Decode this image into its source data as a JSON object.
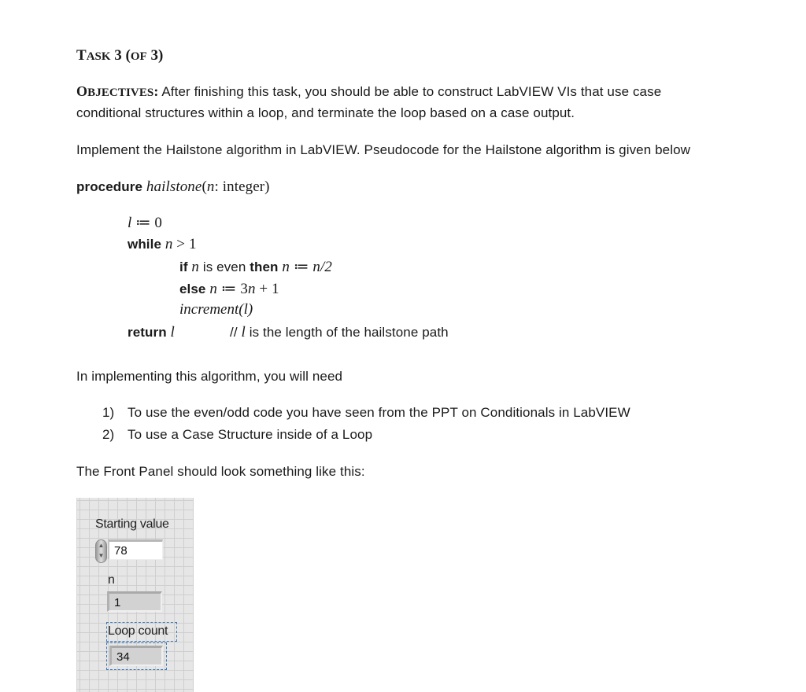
{
  "task": {
    "title_main": "T",
    "title_sc": "ASK",
    "title_rest": " 3 (",
    "title_of": "OF",
    "title_end": " 3)"
  },
  "objectives": {
    "label_first": "O",
    "label_sc": "BJECTIVES",
    "label_colon": ":",
    "line1": " After finishing this task, you should be able to construct LabVIEW VIs that use case",
    "line2": "conditional structures within a loop, and terminate the loop based on a case output."
  },
  "intro": "Implement the Hailstone algorithm in LabVIEW.  Pseudocode for the Hailstone algorithm is given below",
  "pseudocode": {
    "procedure_kw": "procedure",
    "proc_name": "hailstone",
    "proc_args_open": "(",
    "proc_arg_var": "n",
    "proc_arg_type": ": integer)",
    "init": {
      "var": "l",
      "op": " ≔ 0"
    },
    "while": {
      "kw": "while",
      "var": "n",
      "cond": " > 1"
    },
    "if_line": {
      "kw_if": "if",
      "var1": "n",
      "mid": " is even ",
      "kw_then": "then",
      "var2": "n",
      "op": " ≔  ",
      "expr": "n/2"
    },
    "else_line": {
      "kw": "else",
      "var": "n",
      "op": "  ≔ 3",
      "var2": "n",
      "tail": " + 1"
    },
    "increment": "increment(l)",
    "return": {
      "kw": "return",
      "var": "l",
      "comment_prefix": "// ",
      "comment_var": "l",
      "comment_text": " is the length of the hailstone path"
    }
  },
  "needs": {
    "intro": "In implementing this algorithm, you will need",
    "items": [
      {
        "num": "1)",
        "text": "To use the even/odd code you have seen from the PPT on Conditionals in LabVIEW"
      },
      {
        "num": "2)",
        "text": "To use a Case Structure inside of a Loop"
      }
    ]
  },
  "front_panel_intro": "The Front Panel should look something like this:",
  "front_panel": {
    "starting_value": {
      "label": "Starting value",
      "value": "78",
      "spinner_up": "▲",
      "spinner_down": "▼"
    },
    "n": {
      "label": "n",
      "value": "1"
    },
    "loop_count": {
      "label": "Loop count",
      "value": "34"
    }
  }
}
